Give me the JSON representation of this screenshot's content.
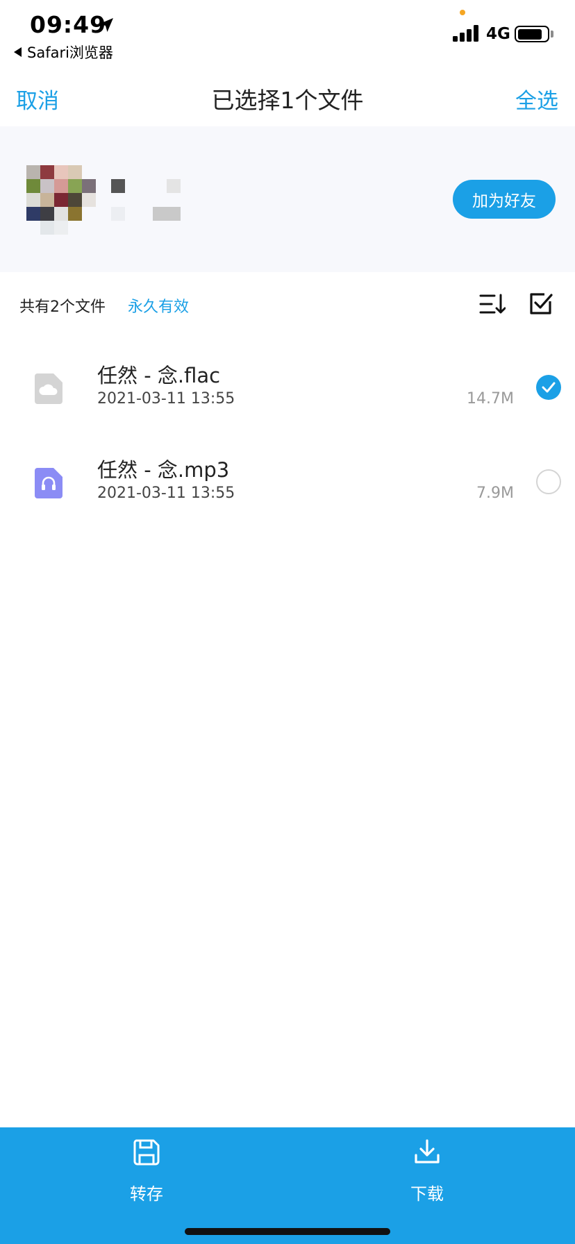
{
  "status_bar": {
    "time": "09:49",
    "back_app": "Safari浏览器",
    "network": "4G",
    "battery_level": 0.85
  },
  "nav": {
    "cancel": "取消",
    "title": "已选择1个文件",
    "select_all": "全选"
  },
  "sharer": {
    "add_friend": "加为好友"
  },
  "info": {
    "file_count": "共有2个文件",
    "validity": "永久有效"
  },
  "files": [
    {
      "name": "任然 - 念.flac",
      "date": "2021-03-11 13:55",
      "size": "14.7M",
      "icon": "cloud-file-icon",
      "selected": true
    },
    {
      "name": "任然 - 念.mp3",
      "date": "2021-03-11 13:55",
      "size": "7.9M",
      "icon": "audio-file-icon",
      "selected": false
    }
  ],
  "bottom_bar": {
    "save": "转存",
    "download": "下载"
  },
  "colors": {
    "accent": "#1ba0e6",
    "audio_icon": "#8b8cf5",
    "generic_icon": "#d4d4d4"
  }
}
